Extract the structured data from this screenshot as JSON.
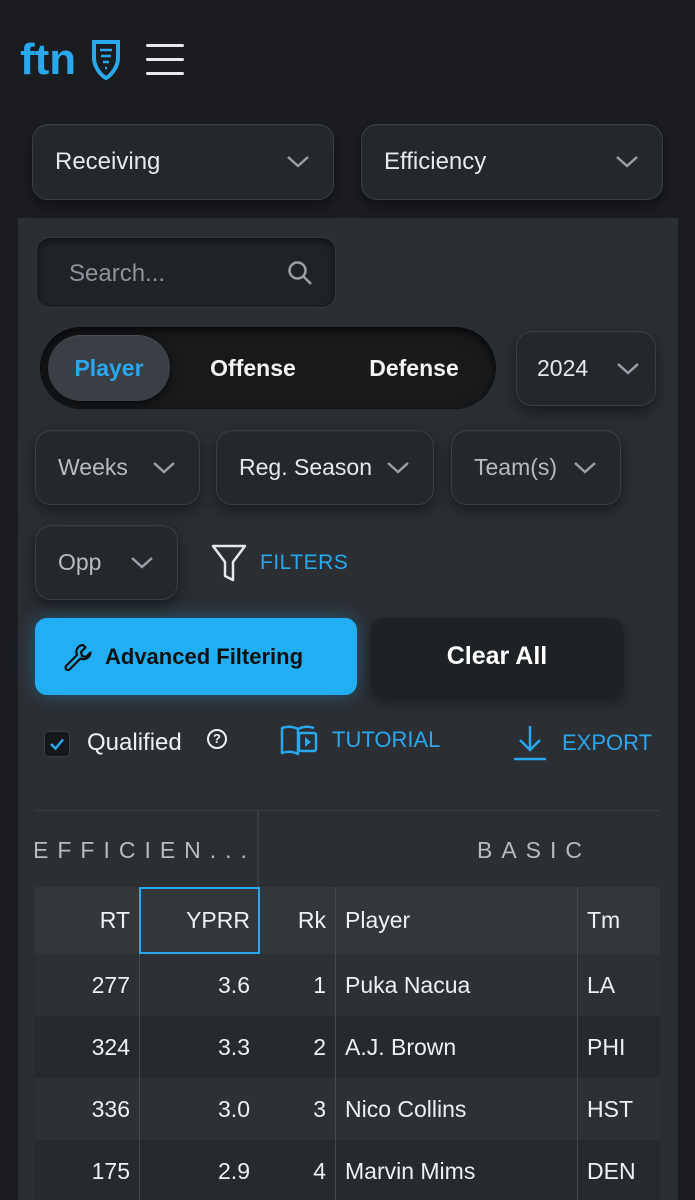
{
  "header": {
    "logo_text": "ftn",
    "menu_icon": "hamburger-icon"
  },
  "category_select": {
    "value": "Receiving"
  },
  "type_select": {
    "value": "Efficiency"
  },
  "search": {
    "placeholder": "Search..."
  },
  "view_toggle": {
    "options": [
      "Player",
      "Offense",
      "Defense"
    ],
    "selected": "Player"
  },
  "season_select": {
    "value": "2024"
  },
  "filters_row": {
    "weeks": "Weeks",
    "season_type": "Reg. Season",
    "teams": "Team(s)",
    "opp": "Opp",
    "filters_label": "FILTERS"
  },
  "buttons": {
    "advanced_filtering": "Advanced Filtering",
    "clear_all": "Clear All"
  },
  "options_row": {
    "qualified_label": "Qualified",
    "qualified_checked": true,
    "help_symbol": "?",
    "tutorial_label": "TUTORIAL",
    "export_label": "EXPORT"
  },
  "table": {
    "group_headers": [
      "EFFICIEN...",
      "BASIC"
    ],
    "columns": [
      "RT",
      "YPRR",
      "Rk",
      "Player",
      "Tm"
    ],
    "sorted_column": "YPRR",
    "rows": [
      {
        "rt": "277",
        "yprr": "3.6",
        "rk": "1",
        "player": "Puka Nacua",
        "tm": "LA"
      },
      {
        "rt": "324",
        "yprr": "3.3",
        "rk": "2",
        "player": "A.J. Brown",
        "tm": "PHI"
      },
      {
        "rt": "336",
        "yprr": "3.0",
        "rk": "3",
        "player": "Nico Collins",
        "tm": "HST"
      },
      {
        "rt": "175",
        "yprr": "2.9",
        "rk": "4",
        "player": "Marvin Mims",
        "tm": "DEN"
      }
    ]
  },
  "colors": {
    "accent": "#2aa8ee",
    "background": "#1b1d20",
    "panel": "#2b2e32"
  }
}
